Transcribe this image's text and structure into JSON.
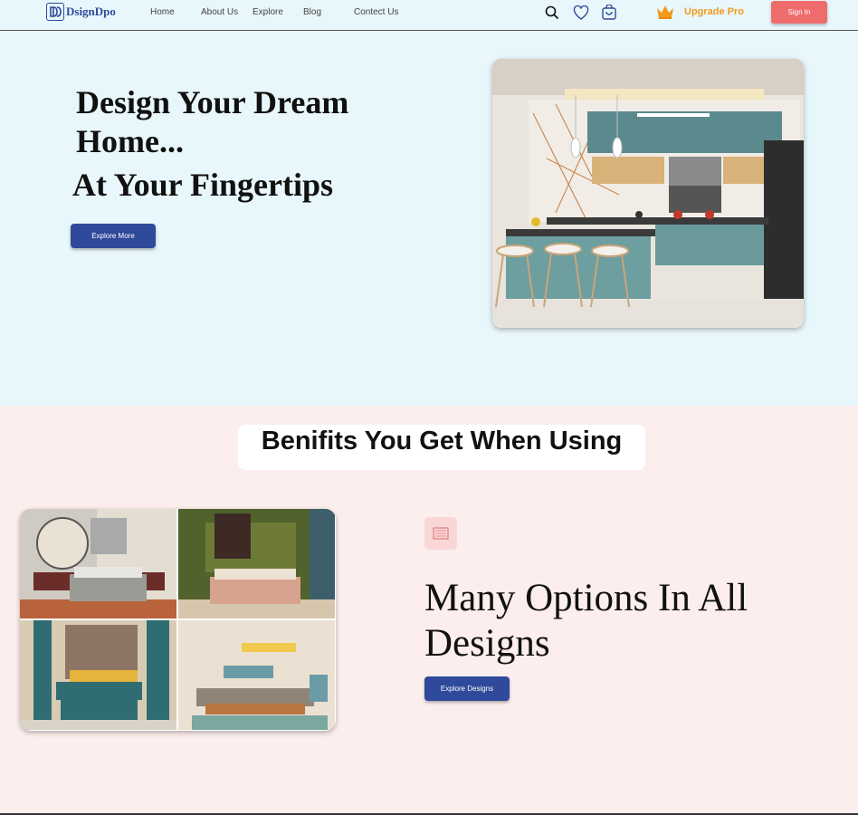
{
  "nav": {
    "brand": "DsignDpo",
    "links": [
      "Home",
      "About Us",
      "Explore",
      "Blog",
      "Contect Us"
    ],
    "icons": [
      "search-icon",
      "heart-icon",
      "cart-icon"
    ],
    "upgrade_label": "Upgrade Pro",
    "signin_label": "Sign In"
  },
  "hero": {
    "title_line1": "Design Your Dream",
    "title_line2": "Home...",
    "title_line3": "At Your Fingertips",
    "button_label": "Explore More"
  },
  "benefits": {
    "heading": "Benifits You Get When Using",
    "feature_title": "Many Options In All Designs",
    "button_label": "Explore Designs"
  },
  "colors": {
    "accent": "#2f4a9a",
    "signin": "#ef6c6c",
    "upgrade": "#f39a1b",
    "hero_bg": "#e8f7fb",
    "section_bg": "#fdeeee"
  }
}
